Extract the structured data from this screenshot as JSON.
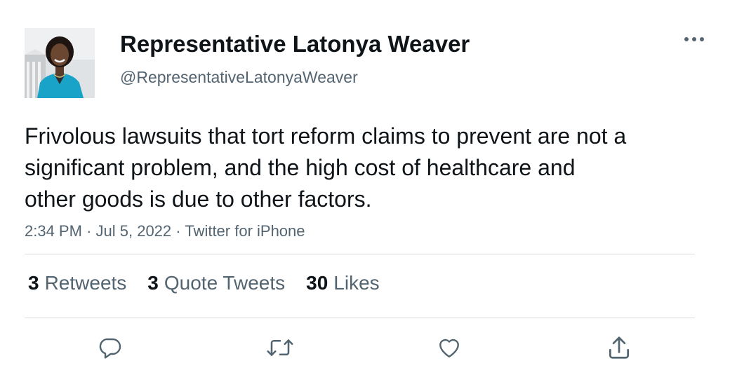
{
  "author": {
    "display_name": "Representative Latonya Weaver",
    "handle": "@RepresentativeLatonyaWeaver",
    "avatar_icon": "profile-photo"
  },
  "tweet": {
    "text": "Frivolous lawsuits that tort reform claims to prevent are not a significant problem, and the high cost of healthcare and other goods is due to other factors.",
    "time": "2:34 PM",
    "date": "Jul 5, 2022",
    "source": "Twitter for iPhone",
    "separator": "·"
  },
  "stats": {
    "retweets": {
      "count": "3",
      "label": "Retweets"
    },
    "quotes": {
      "count": "3",
      "label": "Quote Tweets"
    },
    "likes": {
      "count": "30",
      "label": "Likes"
    }
  },
  "actions": [
    "reply-icon",
    "retweet-icon",
    "like-icon",
    "share-icon"
  ],
  "colors": {
    "text_primary": "#0f1419",
    "text_secondary": "#536471",
    "divider": "#d8dde1",
    "avatar_blazer": "#1aa3c8"
  }
}
